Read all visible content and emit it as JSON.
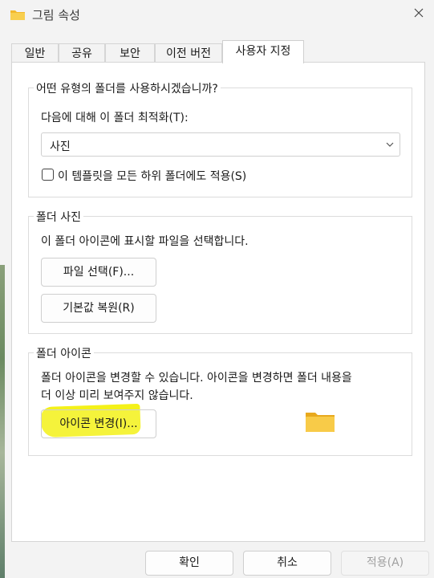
{
  "window": {
    "title": "그림 속성",
    "close_glyph": "✕"
  },
  "tabs": [
    {
      "label": "일반",
      "active": false
    },
    {
      "label": "공유",
      "active": false
    },
    {
      "label": "보안",
      "active": false
    },
    {
      "label": "이전 버전",
      "active": false
    },
    {
      "label": "사용자 지정",
      "active": true
    }
  ],
  "optimize_group": {
    "legend": "어떤 유형의 폴더를 사용하시겠습니까?",
    "optimize_label": "다음에 대해 이 폴더 최적화(T):",
    "optimize_value": "사진",
    "apply_subfolders_label": "이 템플릿을 모든 하위 폴더에도 적용(S)",
    "apply_subfolders_checked": false
  },
  "folder_picture_group": {
    "legend": "폴더 사진",
    "description": "이 폴더 아이콘에 표시할 파일을 선택합니다.",
    "choose_file_button": "파일 선택(F)...",
    "restore_default_button": "기본값 복원(R)"
  },
  "folder_icon_group": {
    "legend": "폴더 아이콘",
    "description_line1": "폴더 아이콘을 변경할 수 있습니다. 아이콘을 변경하면 폴더 내용을",
    "description_line2": "더 이상  미리 보여주지 않습니다.",
    "change_icon_button": "아이콘 변경(I)..."
  },
  "footer": {
    "ok_button": "확인",
    "cancel_button": "취소",
    "apply_button": "적용(A)",
    "apply_enabled": false
  },
  "colors": {
    "highlight": "#f3f000",
    "folder_icon": "#f5c542"
  }
}
